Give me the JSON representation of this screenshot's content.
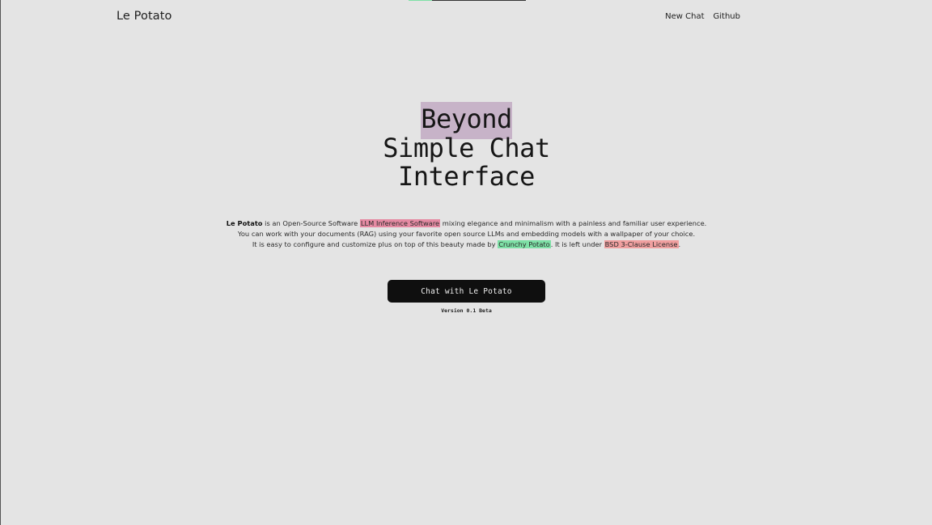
{
  "nav": {
    "brand": "Le Potato",
    "links": [
      "New Chat",
      "Github"
    ]
  },
  "hero": {
    "title_highlight": "Beyond",
    "title_line2": "Simple Chat",
    "title_line3": "Interface"
  },
  "description": {
    "line1": {
      "bold": "Le Potato",
      "pre": " is an Open-Source Software ",
      "tag": "LLM Inference Software",
      "post": " mixing elegance and minimalism with a painless and familiar user experience."
    },
    "line2": "You can work with your documents (RAG) using your favorite open source LLMs and embedding models with a wallpaper of your choice.",
    "line3": {
      "pre": "It is easy to configure and customize plus on top of this beauty made by ",
      "tag_author": "Crunchy Potato",
      "mid": ". It is left under ",
      "tag_license": "BSD 3-Clause License",
      "post": "."
    }
  },
  "cta": {
    "label": "Chat with Le Potato"
  },
  "version": "Version 0.1 Beta",
  "colors": {
    "background": "#e4e4e4",
    "title_highlight": "#c7b3c8",
    "tag_pink": "#e58aa3",
    "tag_green": "#7ee0a6",
    "tag_red": "#f0a0a0",
    "button": "#0f0f0f"
  }
}
